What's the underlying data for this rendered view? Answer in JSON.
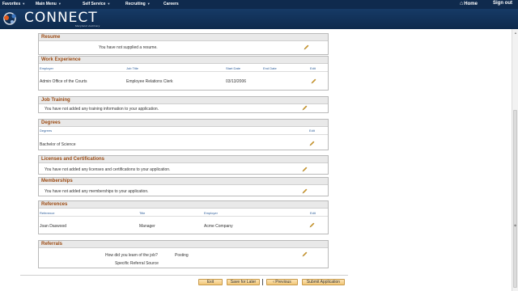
{
  "topnav": {
    "menus": [
      "Favorites",
      "Main Menu",
      "Self Service",
      "Recruiting",
      "Careers"
    ],
    "home": "Home",
    "signout": "Sign out"
  },
  "brand": {
    "name": "CONNECT",
    "subtitle": "Maryland Judiciary"
  },
  "sections": {
    "resume": {
      "title": "Resume",
      "message": "You have not supplied a resume."
    },
    "work": {
      "title": "Work Experience",
      "columns": [
        "Employer",
        "Job Title",
        "Start Date",
        "End Date",
        "Edit"
      ],
      "row": {
        "employer": "Admin Office of the Courts",
        "job_title": "Employee Relations Clerk",
        "start": "03/13/2006",
        "end": ""
      }
    },
    "training": {
      "title": "Job Training",
      "message": "You have not added any training information to your application."
    },
    "degrees": {
      "title": "Degrees",
      "columns": [
        "Degrees",
        "Edit"
      ],
      "row": "Bachelor of Science"
    },
    "licenses": {
      "title": "Licenses and Certifications",
      "message": "You have not added any licenses and certifications to your application."
    },
    "memberships": {
      "title": "Memberships",
      "message": "You have not added any memberships to your application."
    },
    "references": {
      "title": "References",
      "columns": [
        "Reference",
        "Title",
        "Employer",
        "Edit"
      ],
      "row": {
        "reference": "Joan Daswood",
        "title": "Manager",
        "employer": "Acme Company"
      }
    },
    "referrals": {
      "title": "Referrals",
      "question": "How did you learn of the job?",
      "answer": "Posting",
      "source_label": "Specific Referral Source"
    }
  },
  "buttons": {
    "exit": "Exit",
    "save": "Save for Later",
    "previous": "Previous",
    "submit": "Submit Application"
  },
  "colors": {
    "nav": "#0f2a4d",
    "header_text": "#9b4a12",
    "edit_icon": "#e0a020"
  }
}
